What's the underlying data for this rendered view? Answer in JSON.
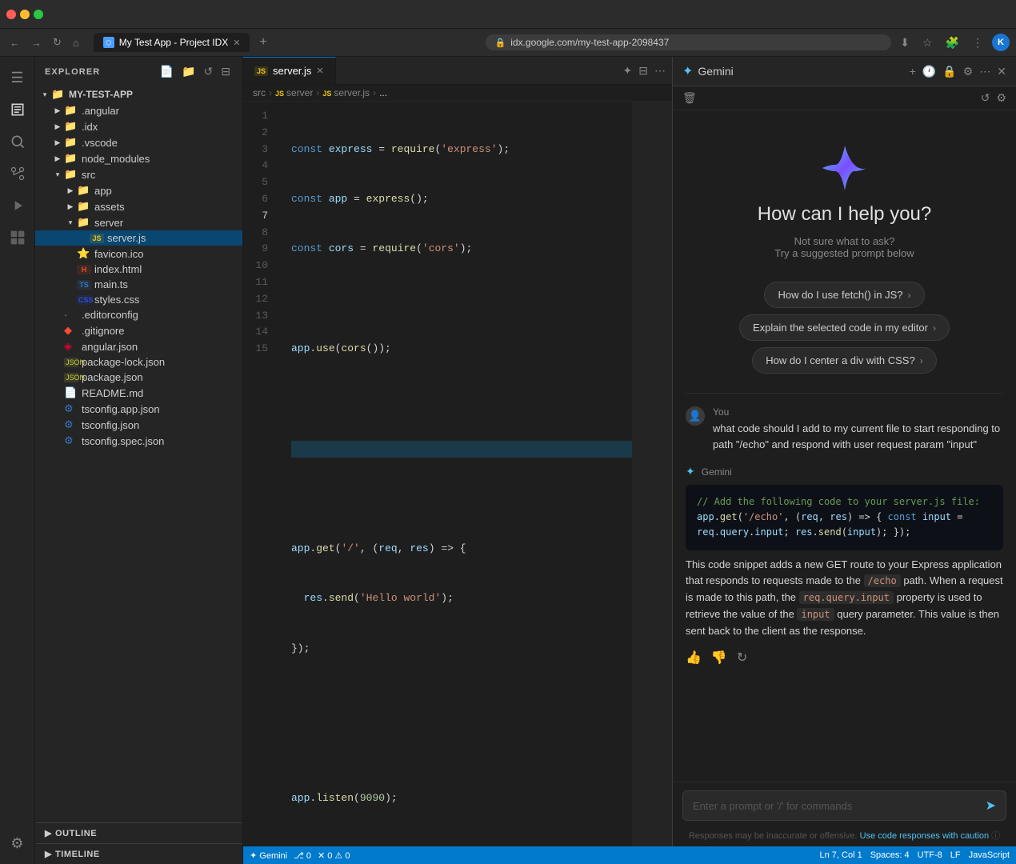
{
  "browser": {
    "tab_label": "My Test App - Project IDX",
    "url": "idx.google.com/my-test-app-2098437",
    "profile_initial": "K"
  },
  "ide": {
    "title": "EXPLORER",
    "project_name": "MY-TEST-APP",
    "sidebar_actions": [
      "new-file",
      "new-folder",
      "refresh",
      "collapse"
    ],
    "file_tree": [
      {
        "name": ".angular",
        "type": "folder",
        "depth": 1,
        "icon": "📁",
        "color": "#e37933",
        "expanded": false
      },
      {
        "name": ".idx",
        "type": "folder",
        "depth": 1,
        "icon": "📁",
        "color": "#4a9eff",
        "expanded": false
      },
      {
        "name": ".vscode",
        "type": "folder",
        "depth": 1,
        "icon": "📁",
        "color": "#4a9eff",
        "expanded": false
      },
      {
        "name": "node_modules",
        "type": "folder",
        "depth": 1,
        "icon": "📁",
        "color": "#dcb67a",
        "expanded": false
      },
      {
        "name": "src",
        "type": "folder",
        "depth": 1,
        "icon": "📁",
        "color": "#e2c36d",
        "expanded": true
      },
      {
        "name": "app",
        "type": "folder",
        "depth": 2,
        "icon": "📁",
        "color": "#e2c36d",
        "expanded": false
      },
      {
        "name": "assets",
        "type": "folder",
        "depth": 2,
        "icon": "📁",
        "color": "#e2c36d",
        "expanded": false
      },
      {
        "name": "server",
        "type": "folder",
        "depth": 2,
        "icon": "📁",
        "color": "#e2c36d",
        "expanded": true
      },
      {
        "name": "server.js",
        "type": "file",
        "depth": 3,
        "icon": "JS",
        "color": "#f1c40f",
        "selected": true
      },
      {
        "name": "favicon.ico",
        "type": "file",
        "depth": 2,
        "icon": "⭐",
        "color": "#f39c12"
      },
      {
        "name": "index.html",
        "type": "file",
        "depth": 2,
        "icon": "HTML",
        "color": "#e44d26"
      },
      {
        "name": "main.ts",
        "type": "file",
        "depth": 2,
        "icon": "TS",
        "color": "#3178c6"
      },
      {
        "name": "styles.css",
        "type": "file",
        "depth": 2,
        "icon": "CSS",
        "color": "#264de4"
      },
      {
        "name": ".editorconfig",
        "type": "file",
        "depth": 1,
        "icon": "·",
        "color": "#888"
      },
      {
        "name": ".gitignore",
        "type": "file",
        "depth": 1,
        "icon": "◆",
        "color": "#f14e32"
      },
      {
        "name": "angular.json",
        "type": "file",
        "depth": 1,
        "icon": "◈",
        "color": "#dd0031"
      },
      {
        "name": "package-lock.json",
        "type": "file",
        "depth": 1,
        "icon": "JSON",
        "color": "#cbcb41"
      },
      {
        "name": "package.json",
        "type": "file",
        "depth": 1,
        "icon": "JSON",
        "color": "#cbcb41"
      },
      {
        "name": "README.md",
        "type": "file",
        "depth": 1,
        "icon": "📄",
        "color": "#4fc3f7"
      },
      {
        "name": "tsconfig.app.json",
        "type": "file",
        "depth": 1,
        "icon": "⚙",
        "color": "#3178c6"
      },
      {
        "name": "tsconfig.json",
        "type": "file",
        "depth": 1,
        "icon": "⚙",
        "color": "#3178c6"
      },
      {
        "name": "tsconfig.spec.json",
        "type": "file",
        "depth": 1,
        "icon": "⚙",
        "color": "#3178c6"
      }
    ],
    "outline_label": "OUTLINE",
    "timeline_label": "TIMELINE",
    "editor_tab": "server.js",
    "breadcrumb": [
      "src",
      "server",
      "server.js",
      "..."
    ],
    "code_lines": [
      {
        "num": 1,
        "code": "const express = require('express');"
      },
      {
        "num": 2,
        "code": "const app = express();"
      },
      {
        "num": 3,
        "code": "const cors = require('cors');"
      },
      {
        "num": 4,
        "code": ""
      },
      {
        "num": 5,
        "code": "app.use(cors());"
      },
      {
        "num": 6,
        "code": ""
      },
      {
        "num": 7,
        "code": "",
        "active": true
      },
      {
        "num": 8,
        "code": ""
      },
      {
        "num": 9,
        "code": "app.get('/', (req, res) => {"
      },
      {
        "num": 10,
        "code": "  res.send('Hello world');"
      },
      {
        "num": 11,
        "code": "});"
      },
      {
        "num": 12,
        "code": ""
      },
      {
        "num": 13,
        "code": ""
      },
      {
        "num": 14,
        "code": "app.listen(9090);"
      },
      {
        "num": 15,
        "code": ""
      }
    ],
    "status_bar": {
      "git": "⎇  0",
      "errors": "✕ 0  ⚠ 0",
      "line_col": "Ln 7, Col 1",
      "spaces": "Spaces: 4",
      "encoding": "UTF-8",
      "eol": "LF",
      "language": "JavaScript"
    }
  },
  "gemini": {
    "panel_title": "Gemini",
    "welcome_title": "How can I help you?",
    "welcome_sub1": "Not sure what to ask?",
    "welcome_sub2": "Try a suggested prompt below",
    "suggestions": [
      "How do I use fetch() in JS?",
      "Explain the selected code in my editor",
      "How do I center a div with CSS?"
    ],
    "user_name": "You",
    "user_query": "what code should I add to my current file to start responding to path \"/echo\" and respond with user request param \"input\"",
    "response_sender": "Gemini",
    "code_response": "// Add the following code to your server.js file:\napp.get('/echo', (req, res) => {\n  const input = req.query.input;\n  res.send(input);\n});",
    "response_text_parts": [
      "This code snippet adds a new GET route to your Express application that responds to requests made to the ",
      "/echo",
      " path. When a request is made to this path, the ",
      "req.query.input",
      " property is used to retrieve the value of the ",
      "input",
      " query parameter. This value is then sent back to the client as the response."
    ],
    "input_placeholder": "Enter a prompt or '/' for commands",
    "footer_text": "Responses may be inaccurate or offensive.",
    "footer_link": "Use code responses with caution",
    "footer_info": "ⓘ"
  }
}
